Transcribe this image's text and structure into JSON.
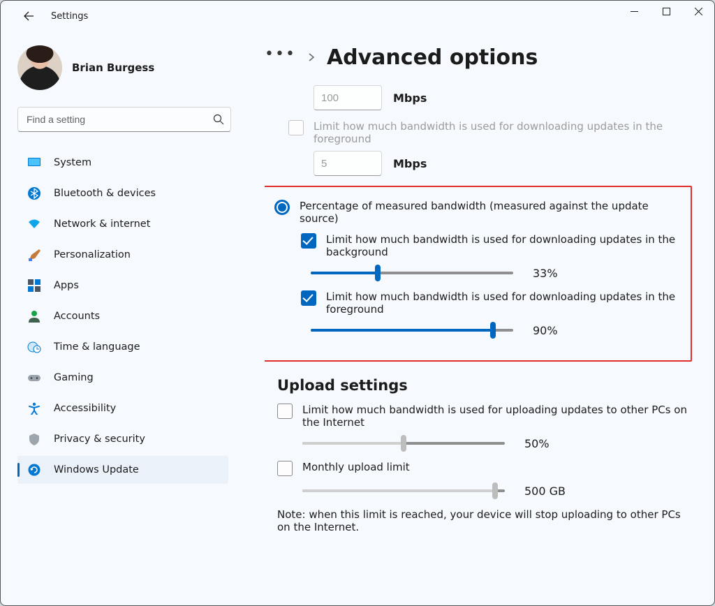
{
  "window": {
    "title": "Settings"
  },
  "profile": {
    "name": "Brian Burgess"
  },
  "search": {
    "placeholder": "Find a setting"
  },
  "sidebar": {
    "items": [
      {
        "label": "System"
      },
      {
        "label": "Bluetooth & devices"
      },
      {
        "label": "Network & internet"
      },
      {
        "label": "Personalization"
      },
      {
        "label": "Apps"
      },
      {
        "label": "Accounts"
      },
      {
        "label": "Time & language"
      },
      {
        "label": "Gaming"
      },
      {
        "label": "Accessibility"
      },
      {
        "label": "Privacy & security"
      },
      {
        "label": "Windows Update"
      }
    ],
    "selected_index": 10
  },
  "page": {
    "title": "Advanced options"
  },
  "absolute": {
    "bg_value": "100",
    "bg_unit": "Mbps",
    "fg_label": "Limit how much bandwidth is used for downloading updates in the foreground",
    "fg_value": "5",
    "fg_unit": "Mbps"
  },
  "percentage": {
    "radio_label": "Percentage of measured bandwidth (measured against the update source)",
    "bg_label": "Limit how much bandwidth is used for downloading updates in the background",
    "bg_percent": 33,
    "bg_display": "33%",
    "fg_label": "Limit how much bandwidth is used for downloading updates in the foreground",
    "fg_percent": 90,
    "fg_display": "90%"
  },
  "upload": {
    "heading": "Upload settings",
    "limit_label": "Limit how much bandwidth is used for uploading updates to other PCs on the Internet",
    "limit_percent": 50,
    "limit_display": "50%",
    "monthly_label": "Monthly upload limit",
    "monthly_percent": 95,
    "monthly_display": "500 GB",
    "note": "Note: when this limit is reached, your device will stop uploading to other PCs on the Internet."
  }
}
